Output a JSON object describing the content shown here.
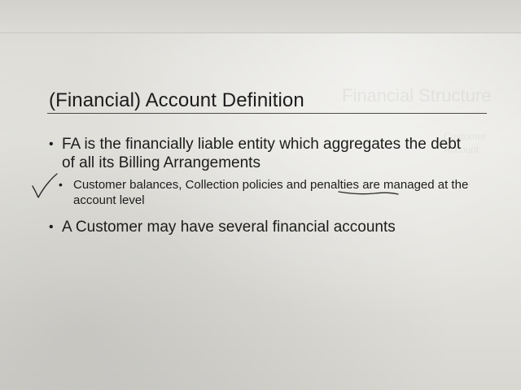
{
  "slide": {
    "title": "(Financial) Account Definition",
    "bullets": [
      {
        "level": 1,
        "marker": "•",
        "text": "FA is the financially liable entity which aggregates the debt of all its Billing Arrangements"
      },
      {
        "level": 2,
        "marker": "•",
        "text": "Customer balances, Collection policies and penalties are managed at the account level"
      },
      {
        "level": 1,
        "marker": "•",
        "text": "A Customer  may have several financial accounts"
      }
    ]
  },
  "annotations": {
    "checkmark_color": "#2a2a2a",
    "underline_color": "#2a2a2a"
  },
  "colors": {
    "paper": "#e4e3de",
    "text": "#1c1c1c",
    "rule": "#4a4a4a"
  }
}
